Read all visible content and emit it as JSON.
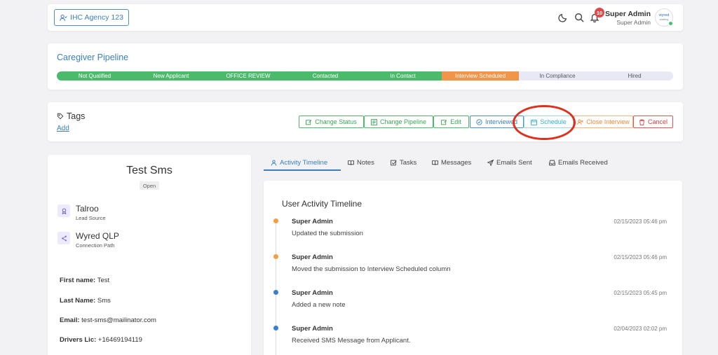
{
  "header": {
    "agency_label": "IHC Agency 123",
    "notification_count": "10",
    "user_name": "Super Admin",
    "user_role": "Super Admin",
    "avatar_text_1": "wyred",
    "avatar_text_2": "staffing"
  },
  "pipeline": {
    "title": "Caregiver Pipeline",
    "stages": [
      {
        "label": "Not Qualified",
        "state": "done"
      },
      {
        "label": "New Applicant",
        "state": "done"
      },
      {
        "label": "OFFICE REVIEW",
        "state": "done"
      },
      {
        "label": "Contacted",
        "state": "done"
      },
      {
        "label": "In Contact",
        "state": "done"
      },
      {
        "label": "Interview Scheduled",
        "state": "current"
      },
      {
        "label": "In Compliance",
        "state": "todo"
      },
      {
        "label": "Hired",
        "state": "todo"
      }
    ]
  },
  "tags": {
    "title": "Tags",
    "add_label": "Add"
  },
  "actions": {
    "change_status": "Change Status",
    "change_pipeline": "Change Pipeline",
    "edit": "Edit",
    "interviewed": "Interviewed",
    "schedule": "Schedule",
    "close_interview": "Close Interview",
    "cancel": "Cancel"
  },
  "profile": {
    "name": "Test Sms",
    "status": "Open",
    "lead_source_value": "Talroo",
    "lead_source_label": "Lead Source",
    "connection_value": "Wyred QLP",
    "connection_label": "Connection Path",
    "fields": [
      {
        "label": "First name:",
        "value": "Test"
      },
      {
        "label": "Last Name:",
        "value": "Sms"
      },
      {
        "label": "Email:",
        "value": "test-sms@mailinator.com"
      },
      {
        "label": "Drivers Lic:",
        "value": "+16469194119"
      }
    ]
  },
  "tabs": [
    {
      "label": "Activity Timeline",
      "icon": "user-icon",
      "active": true
    },
    {
      "label": "Notes",
      "icon": "book-icon"
    },
    {
      "label": "Tasks",
      "icon": "checkbox-icon"
    },
    {
      "label": "Messages",
      "icon": "book-icon"
    },
    {
      "label": "Emails Sent",
      "icon": "send-icon"
    },
    {
      "label": "Emails Received",
      "icon": "inbox-icon"
    }
  ],
  "timeline": {
    "title": "User Activity Timeline",
    "entries": [
      {
        "who": "Super Admin",
        "date": "02/15/2023 05:46 pm",
        "msg": "Updated the submission",
        "color": "#f0a040"
      },
      {
        "who": "Super Admin",
        "date": "02/15/2023 05:46 pm",
        "msg": "Moved the submission to Interview Scheduled column",
        "color": "#f0a040"
      },
      {
        "who": "Super Admin",
        "date": "02/15/2023 05:45 pm",
        "msg": "Added a new note",
        "color": "#3a7fd0"
      },
      {
        "who": "Super Admin",
        "date": "02/04/2023 02:02 pm",
        "msg": "Received SMS Message from Applicant.",
        "color": "#3a7fd0"
      }
    ]
  },
  "colors": {
    "accent": "#3a7fc0",
    "done": "#4cba6b",
    "current": "#f0954a",
    "highlight": "#e0301c"
  }
}
